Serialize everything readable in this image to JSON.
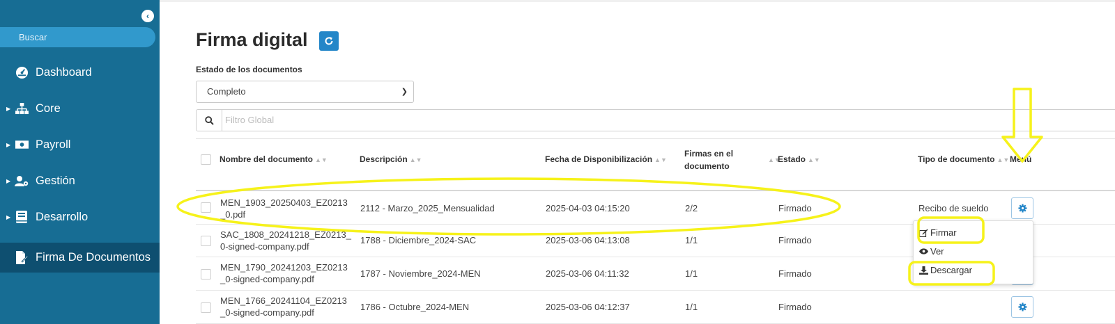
{
  "sidebar": {
    "search_placeholder": "Buscar",
    "items": [
      {
        "label": "Dashboard",
        "icon": "dashboard-icon",
        "has_caret": false
      },
      {
        "label": "Core",
        "icon": "sitemap-icon",
        "has_caret": true
      },
      {
        "label": "Payroll",
        "icon": "money-icon",
        "has_caret": true
      },
      {
        "label": "Gestión",
        "icon": "user-cog-icon",
        "has_caret": true
      },
      {
        "label": "Desarrollo",
        "icon": "book-icon",
        "has_caret": true
      },
      {
        "label": "Firma De Documentos",
        "icon": "file-signature-icon",
        "has_caret": false
      }
    ]
  },
  "page": {
    "title": "Firma digital",
    "filter_label": "Estado de los documentos",
    "filter_value": "Completo",
    "global_filter_placeholder": "Filtro Global"
  },
  "table": {
    "headers": {
      "name": "Nombre del documento",
      "description": "Descripción",
      "date": "Fecha de Disponibilización",
      "signatures_line1": "Firmas en el",
      "signatures_line2": "documento",
      "state": "Estado",
      "type": "Tipo de documento",
      "menu": "Menú"
    },
    "rows": [
      {
        "name1": "MEN_1903_20250403_EZ0213",
        "name2": "_0.pdf",
        "description": "2112 - Marzo_2025_Mensualidad",
        "date": "2025-04-03 04:15:20",
        "signatures": "2/2",
        "state": "Firmado",
        "type": "Recibo de sueldo"
      },
      {
        "name1": "SAC_1808_20241218_EZ0213_",
        "name2": "0-signed-company.pdf",
        "description": "1788 - Diciembre_2024-SAC",
        "date": "2025-03-06 04:13:08",
        "signatures": "1/1",
        "state": "Firmado",
        "type": ""
      },
      {
        "name1": "MEN_1790_20241203_EZ0213",
        "name2": "_0-signed-company.pdf",
        "description": "1787 - Noviembre_2024-MEN",
        "date": "2025-03-06 04:11:32",
        "signatures": "1/1",
        "state": "Firmado",
        "type": ""
      },
      {
        "name1": "MEN_1766_20241104_EZ0213",
        "name2": "_0-signed-company.pdf",
        "description": "1786 - Octubre_2024-MEN",
        "date": "2025-03-06 04:12:37",
        "signatures": "1/1",
        "state": "Firmado",
        "type": ""
      }
    ]
  },
  "dropdown": {
    "sign": "Firmar",
    "view": "Ver",
    "download": "Descargar"
  },
  "colors": {
    "sidebar": "#176d94",
    "sidebar_active": "#0e4f70",
    "accent": "#2386c8",
    "annotation": "#f6f21a"
  }
}
